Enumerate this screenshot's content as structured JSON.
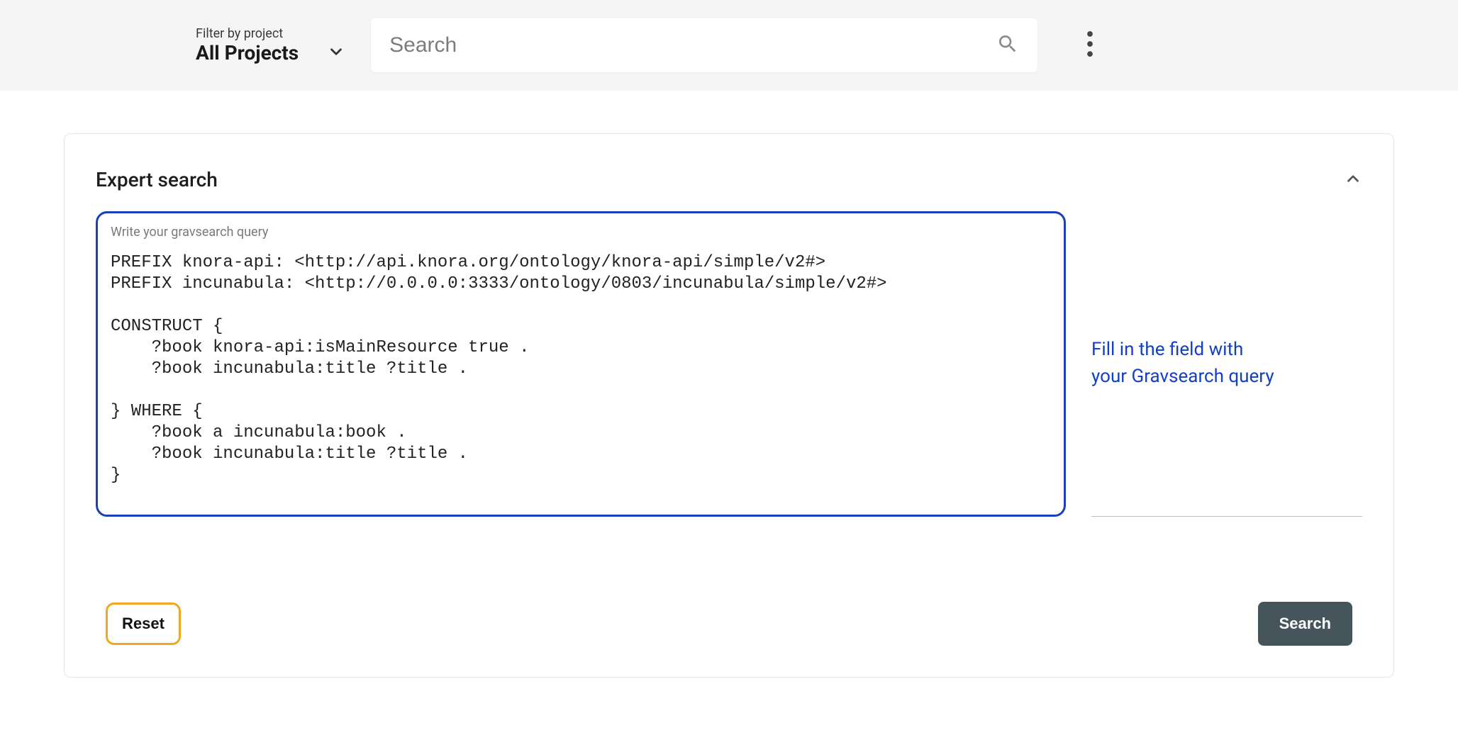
{
  "topbar": {
    "filter_label": "Filter by project",
    "filter_value": "All Projects",
    "search_placeholder": "Search"
  },
  "card": {
    "title": "Expert search",
    "query_label": "Write your gravsearch query",
    "query_value": "PREFIX knora-api: <http://api.knora.org/ontology/knora-api/simple/v2#>\nPREFIX incunabula: <http://0.0.0.0:3333/ontology/0803/incunabula/simple/v2#>\n\nCONSTRUCT {\n    ?book knora-api:isMainResource true .\n    ?book incunabula:title ?title .\n\n} WHERE {\n    ?book a incunabula:book .\n    ?book incunabula:title ?title .\n}",
    "hint_line1": "Fill in the field with",
    "hint_line2": "your Gravsearch query",
    "reset_label": "Reset",
    "search_label": "Search"
  }
}
